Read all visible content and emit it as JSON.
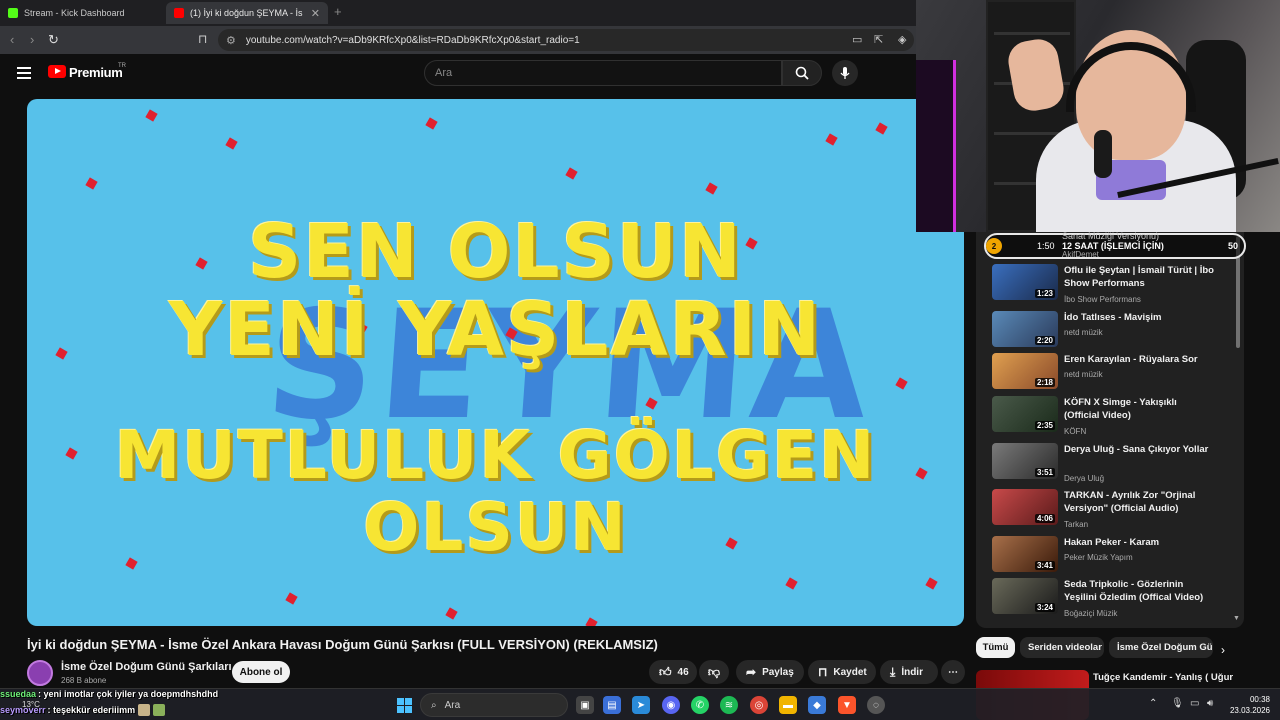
{
  "browser": {
    "tabs": [
      {
        "label": "Stream - Kick Dashboard",
        "favicon_color": "#53fc18"
      },
      {
        "label": "(1) İyi ki doğdun ŞEYMA - İs",
        "favicon_color": "#ff0000"
      }
    ],
    "new_tab": "+",
    "url": "youtube.com/watch?v=aDb9KRfcXp0&list=RDaDb9KRfcXp0&start_radio=1"
  },
  "youtube": {
    "brand": "Premium",
    "region": "TR",
    "search_placeholder": "Ara"
  },
  "video": {
    "lyrics": [
      "SEN OLSUN",
      "YENİ YAŞLARIN",
      "MUTLULUK GÖLGEN",
      "OLSUN"
    ],
    "ghost_name": "ŞEYMA",
    "title": "İyi ki doğdun ŞEYMA - İsme Özel Ankara Havası Doğum Günü Şarkısı (FULL VERSİYON) (REKLAMSIZ)",
    "channel": "İsme Özel Doğum Günü Şarkıları",
    "subscribers": "268 B abone",
    "subscribe_label": "Abone ol",
    "likes": "46",
    "share_label": "Paylaş",
    "save_label": "Kaydet",
    "download_label": "İndir"
  },
  "playlist": {
    "current": {
      "index": "2",
      "top_text": "Sanat Müziği Versiyonu)",
      "title": "12 SAAT (İŞLEMCİ İÇİN)",
      "duration": "1:50",
      "channel": "AkifDemet",
      "count": "50"
    },
    "items": [
      {
        "title": "Oflu ile Şeytan | İsmail Türüt | İbo Show Performans",
        "channel": "İbo Show Performans",
        "duration": "1:23",
        "color": "#3a6fbf"
      },
      {
        "title": "İdo Tatlıses - Mavişim",
        "channel": "netd müzik",
        "duration": "2:20",
        "color": "#4a7aa8"
      },
      {
        "title": "Eren Karayılan - Rüyalara Sor",
        "channel": "netd müzik",
        "duration": "2:18",
        "color": "#c88a3a"
      },
      {
        "title": "KÖFN X Simge - Yakışıklı (Official Video)",
        "channel": "KÖFN",
        "duration": "2:35",
        "color": "#3a4a3a"
      },
      {
        "title": "Derya Uluğ - Sana Çıkıyor Yollar",
        "channel": "Derya Uluğ",
        "duration": "3:51",
        "color": "#6a6a6a"
      },
      {
        "title": "TARKAN - Ayrılık Zor \"Orjinal Versiyon\" (Official Audio)",
        "channel": "Tarkan",
        "duration": "4:06",
        "color": "#a83a3a"
      },
      {
        "title": "Hakan Peker - Karam",
        "channel": "Peker Müzik Yapım",
        "duration": "3:41",
        "color": "#8a5a3a"
      },
      {
        "title": "Seda Tripkolic - Gözlerinin Yeşilini Özledim (Offical Video)",
        "channel": "Boğaziçi Müzik",
        "duration": "3:24",
        "color": "#5a5a4a"
      }
    ]
  },
  "chips": [
    "Tümü",
    "Seriden videolar",
    "İsme Özel Doğum Gü"
  ],
  "next_video": {
    "title": "Tuğçe Kandemir - Yanlış ( Uğur"
  },
  "chat": [
    {
      "user": "ssuedaa",
      "text": ": yeni imotlar çok iyiler ya doepmdhshdhd"
    },
    {
      "user": "seymoverr",
      "text": ": teşekkür ederiiimm"
    }
  ],
  "taskbar": {
    "search_placeholder": "Ara",
    "weather": "13°C",
    "time": "00:38",
    "date": "23.03.2026"
  }
}
